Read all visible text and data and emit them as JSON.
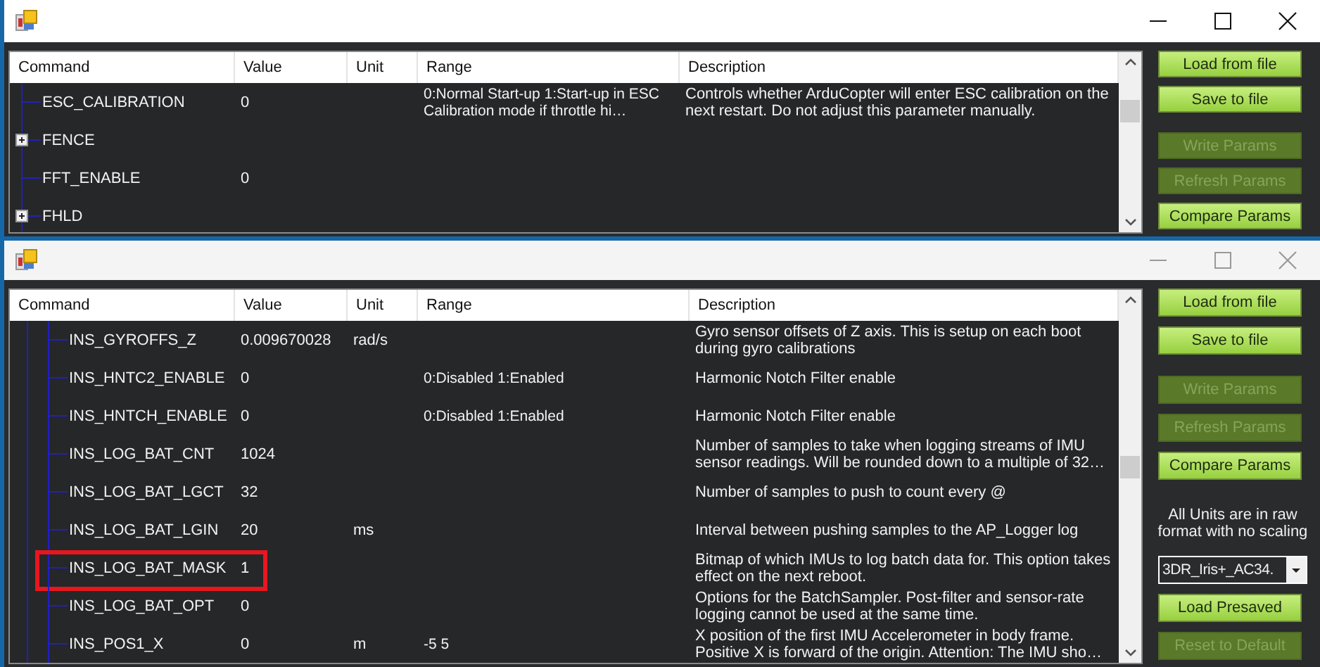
{
  "windows": [
    {
      "active": true,
      "table": {
        "in_group": false,
        "columns": [
          "Command",
          "Value",
          "Unit",
          "Range",
          "Description"
        ],
        "rows": [
          {
            "kind": "param",
            "command": "ESC_CALIBRATION",
            "value": "0",
            "range": "0:Normal Start-up  1:Start-up in ESC Calibration mode if throttle hi…",
            "description": "Controls whether ArduCopter will enter ESC calibration on the next restart.  Do not adjust this parameter manually.",
            "highlighted": false
          },
          {
            "kind": "group",
            "command": "FENCE",
            "expanded": false
          },
          {
            "kind": "param",
            "command": "FFT_ENABLE",
            "value": "0",
            "highlighted": false
          },
          {
            "kind": "group",
            "command": "FHLD",
            "expanded": false
          }
        ]
      },
      "side_panel": [
        {
          "kind": "button",
          "label": "Load from file",
          "disabled": false
        },
        {
          "kind": "button",
          "label": "Save to file",
          "disabled": false
        },
        {
          "kind": "button",
          "label": "Write Params",
          "disabled": true
        },
        {
          "kind": "button",
          "label": "Refresh Params",
          "disabled": true
        },
        {
          "kind": "button",
          "label": "Compare Params",
          "disabled": false
        }
      ]
    },
    {
      "active": false,
      "table": {
        "in_group": true,
        "columns": [
          "Command",
          "Value",
          "Unit",
          "Range",
          "Description"
        ],
        "rows": [
          {
            "kind": "param",
            "command": "INS_GYROFFS_Z",
            "value": "0.009670028",
            "unit": "rad/s",
            "description": "Gyro sensor offsets of Z axis. This is setup on each boot during gyro calibrations",
            "highlighted": false
          },
          {
            "kind": "param",
            "command": "INS_HNTC2_ENABLE",
            "value": "0",
            "range": "0:Disabled 1:Enabled",
            "description": "Harmonic Notch Filter enable",
            "highlighted": false
          },
          {
            "kind": "param",
            "command": "INS_HNTCH_ENABLE",
            "value": "0",
            "range": "0:Disabled 1:Enabled",
            "description": "Harmonic Notch Filter enable",
            "highlighted": false
          },
          {
            "kind": "param",
            "command": "INS_LOG_BAT_CNT",
            "value": "1024",
            "description": "Number of samples to take when logging streams of IMU sensor readings.  Will be rounded down to a multiple of 32…",
            "highlighted": false
          },
          {
            "kind": "param",
            "command": "INS_LOG_BAT_LGCT",
            "value": "32",
            "description": "Number of samples to push to count every @",
            "highlighted": false
          },
          {
            "kind": "param",
            "command": "INS_LOG_BAT_LGIN",
            "value": "20",
            "unit": "ms",
            "description": "Interval between pushing samples to the AP_Logger log",
            "highlighted": false
          },
          {
            "kind": "param",
            "command": "INS_LOG_BAT_MASK",
            "value": "1",
            "description": "Bitmap of which IMUs to log batch data for. This option takes effect on the next reboot.",
            "highlighted": true
          },
          {
            "kind": "param",
            "command": "INS_LOG_BAT_OPT",
            "value": "0",
            "description": "Options for the BatchSampler. Post-filter and sensor-rate logging cannot be used at the same time.",
            "highlighted": false
          },
          {
            "kind": "param",
            "command": "INS_POS1_X",
            "value": "0",
            "unit": "m",
            "range": "-5 5",
            "description": "X position of the first IMU Accelerometer in body frame. Positive X is forward of the origin. Attention: The IMU sho…",
            "highlighted": false
          }
        ]
      },
      "side_panel": [
        {
          "kind": "button",
          "label": "Load from file",
          "disabled": false
        },
        {
          "kind": "button",
          "label": "Save to file",
          "disabled": false
        },
        {
          "kind": "button",
          "label": "Write Params",
          "disabled": true
        },
        {
          "kind": "button",
          "label": "Refresh Params",
          "disabled": true
        },
        {
          "kind": "button",
          "label": "Compare Params",
          "disabled": false
        },
        {
          "kind": "note",
          "text": "All Units are in raw format with no scaling"
        },
        {
          "kind": "dropdown",
          "value": "3DR_Iris+_AC34."
        },
        {
          "kind": "button",
          "label": "Load Presaved",
          "disabled": false
        },
        {
          "kind": "button",
          "label": "Reset to Default",
          "disabled": true
        }
      ]
    }
  ]
}
